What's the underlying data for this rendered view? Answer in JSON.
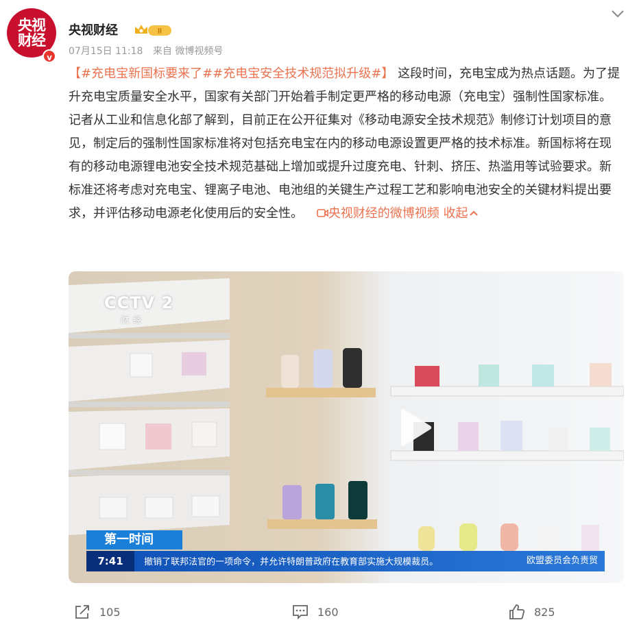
{
  "post": {
    "avatar_line1": "央视",
    "avatar_line2": "财经",
    "verified_mark": "v",
    "username": "央视财经",
    "level_badge": "II",
    "date": "07月15日 11:18",
    "source": "来自 微博视频号",
    "content": {
      "tag_open": "【",
      "tag": "#充电宝新国标要来了##充电宝安全技术规范拟升级#",
      "tag_close": "】",
      "body": "这段时间，充电宝成为热点话题。为了提升充电宝质量安全水平，国家有关部门开始着手制定更严格的移动电源（充电宝）强制性国家标准。记者从工业和信息化部了解到，目前正在公开征集对《移动电源安全技术规范》制修订计划项目的意见，制定后的强制性国家标准将对包括充电宝在内的移动电源设置更严格的技术标准。新国标将在现有的移动电源锂电池安全技术规范基础上增加或提升过度充电、针刺、挤压、热滥用等试验要求。新标准还将考虑对充电宝、锂离子电池、电池组的关键生产过程工艺和影响电池安全的关键材料提出要求，并评估移动电源老化使用后的安全性。",
      "video_link": "央视财经的微博视频",
      "collapse": "收起"
    }
  },
  "video": {
    "channel_logo": "CCTV 2",
    "channel_sub": "财经",
    "program": "第一时间",
    "clock": "7:41",
    "ticker": "撤销了联邦法官的一项命令，并允许特朗普政府在教育部实施大规模裁员。",
    "ticker_right": "欧盟委员会负责贸"
  },
  "actions": {
    "repost_count": "105",
    "comment_count": "160",
    "like_count": "825"
  },
  "icons": {
    "dropdown": "chevron-down-icon",
    "video_link": "video-icon",
    "play": "play-icon",
    "repost": "share-icon",
    "comment": "comment-icon",
    "like": "thumbs-up-icon"
  },
  "colors": {
    "accent": "#eb7350",
    "avatar_bg": "#c8102e",
    "ticker_blue": "#1a7fd8"
  }
}
